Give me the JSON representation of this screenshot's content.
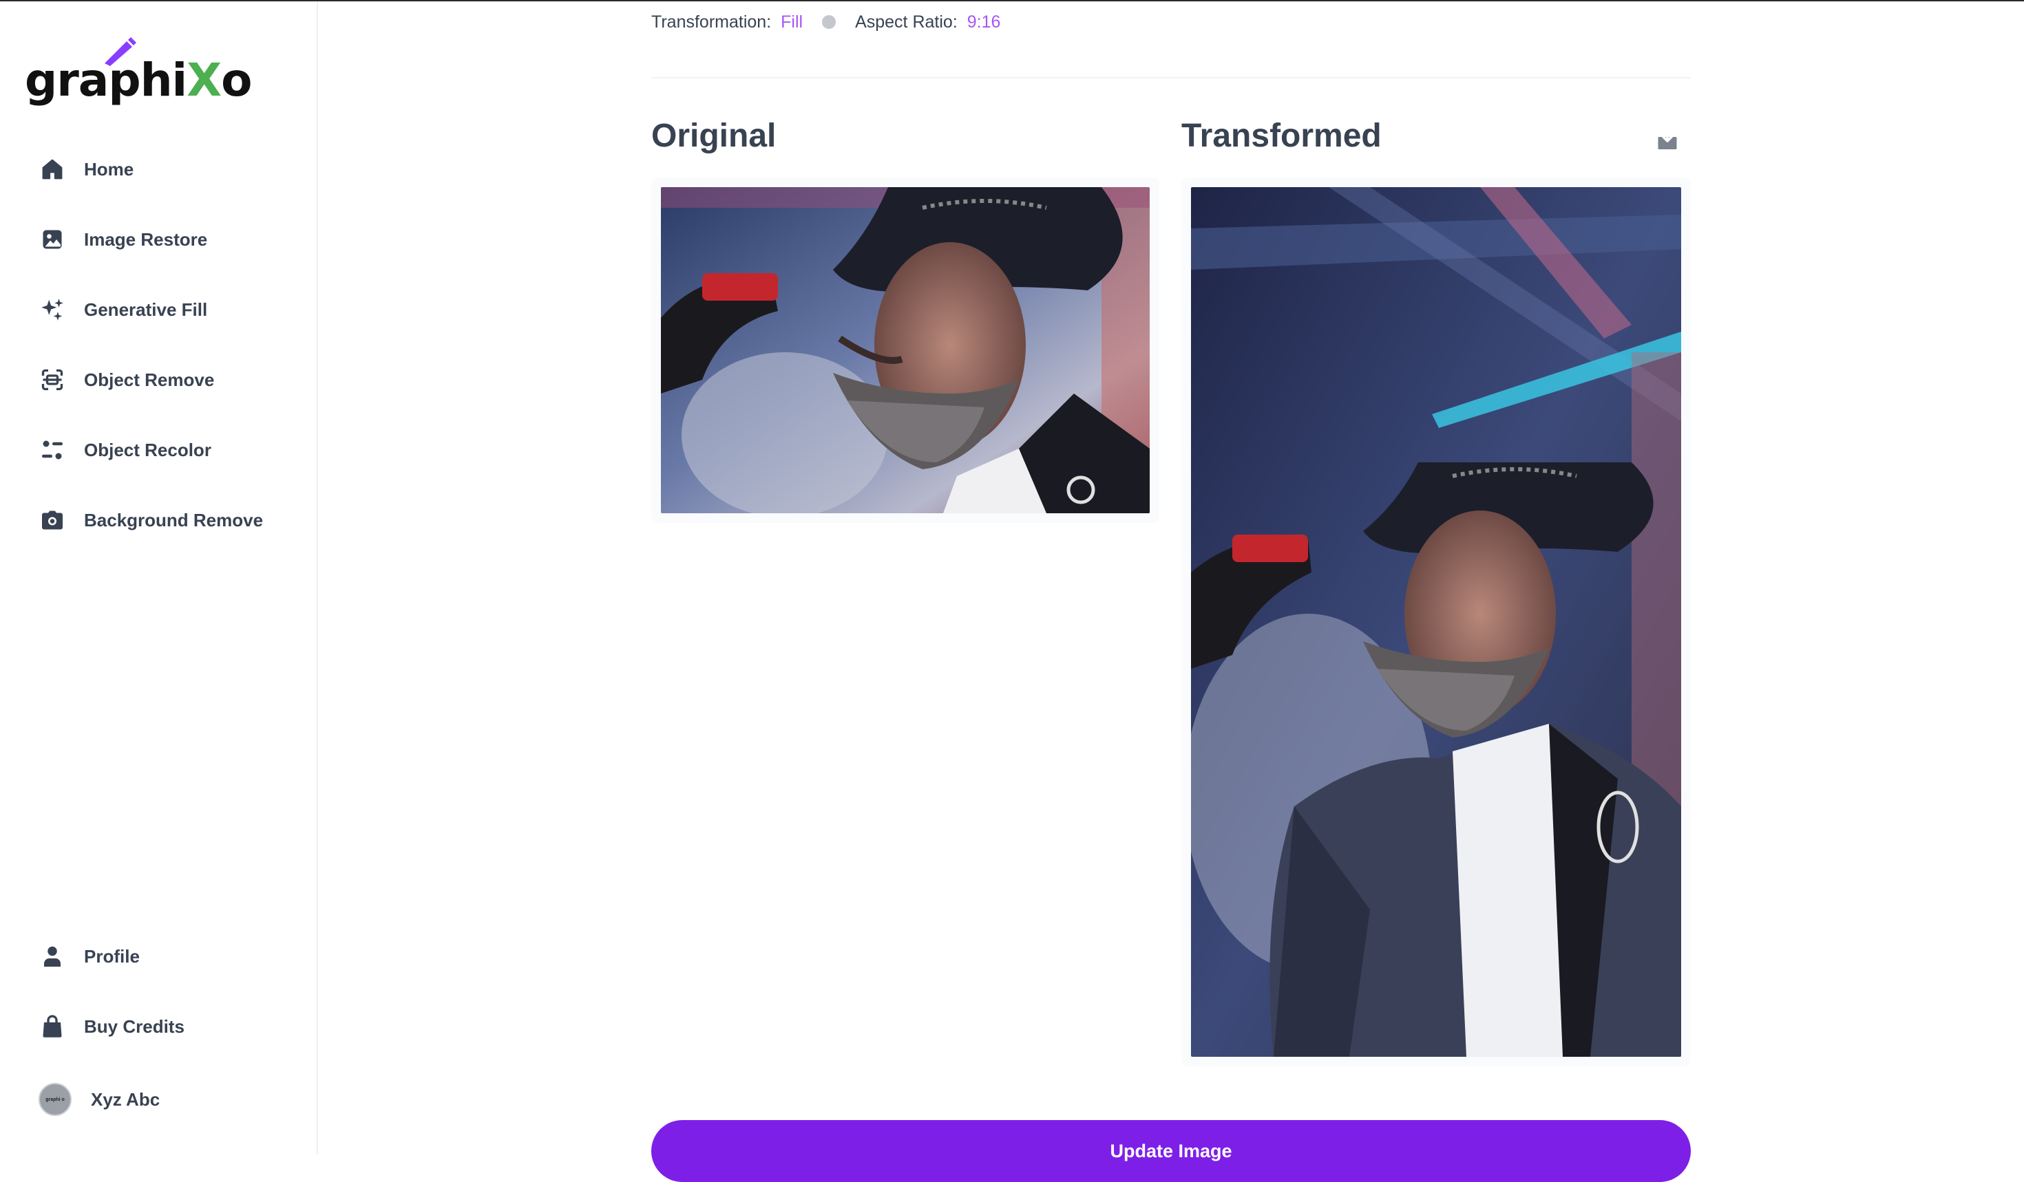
{
  "app": {
    "logo_text_a": "graphi",
    "logo_text_x": "X",
    "logo_text_b": "o",
    "brand_purple": "#7e1fe8",
    "brand_green": "#4caf50"
  },
  "sidebar": {
    "items": [
      {
        "label": "Home",
        "icon": "home-icon"
      },
      {
        "label": "Image Restore",
        "icon": "image-icon"
      },
      {
        "label": "Generative Fill",
        "icon": "sparkles-icon"
      },
      {
        "label": "Object Remove",
        "icon": "scan-icon"
      },
      {
        "label": "Object Recolor",
        "icon": "filter-icon"
      },
      {
        "label": "Background Remove",
        "icon": "camera-icon"
      }
    ],
    "bottom_items": [
      {
        "label": "Profile",
        "icon": "user-icon"
      },
      {
        "label": "Buy Credits",
        "icon": "bag-icon"
      }
    ],
    "user": {
      "name": "Xyz Abc",
      "avatar_text": "graphi o"
    }
  },
  "meta": {
    "transformation_label": "Transformation:",
    "transformation_value": "Fill",
    "aspect_label": "Aspect Ratio:",
    "aspect_value": "9:16"
  },
  "main": {
    "original_heading": "Original",
    "transformed_heading": "Transformed",
    "update_button": "Update Image"
  }
}
